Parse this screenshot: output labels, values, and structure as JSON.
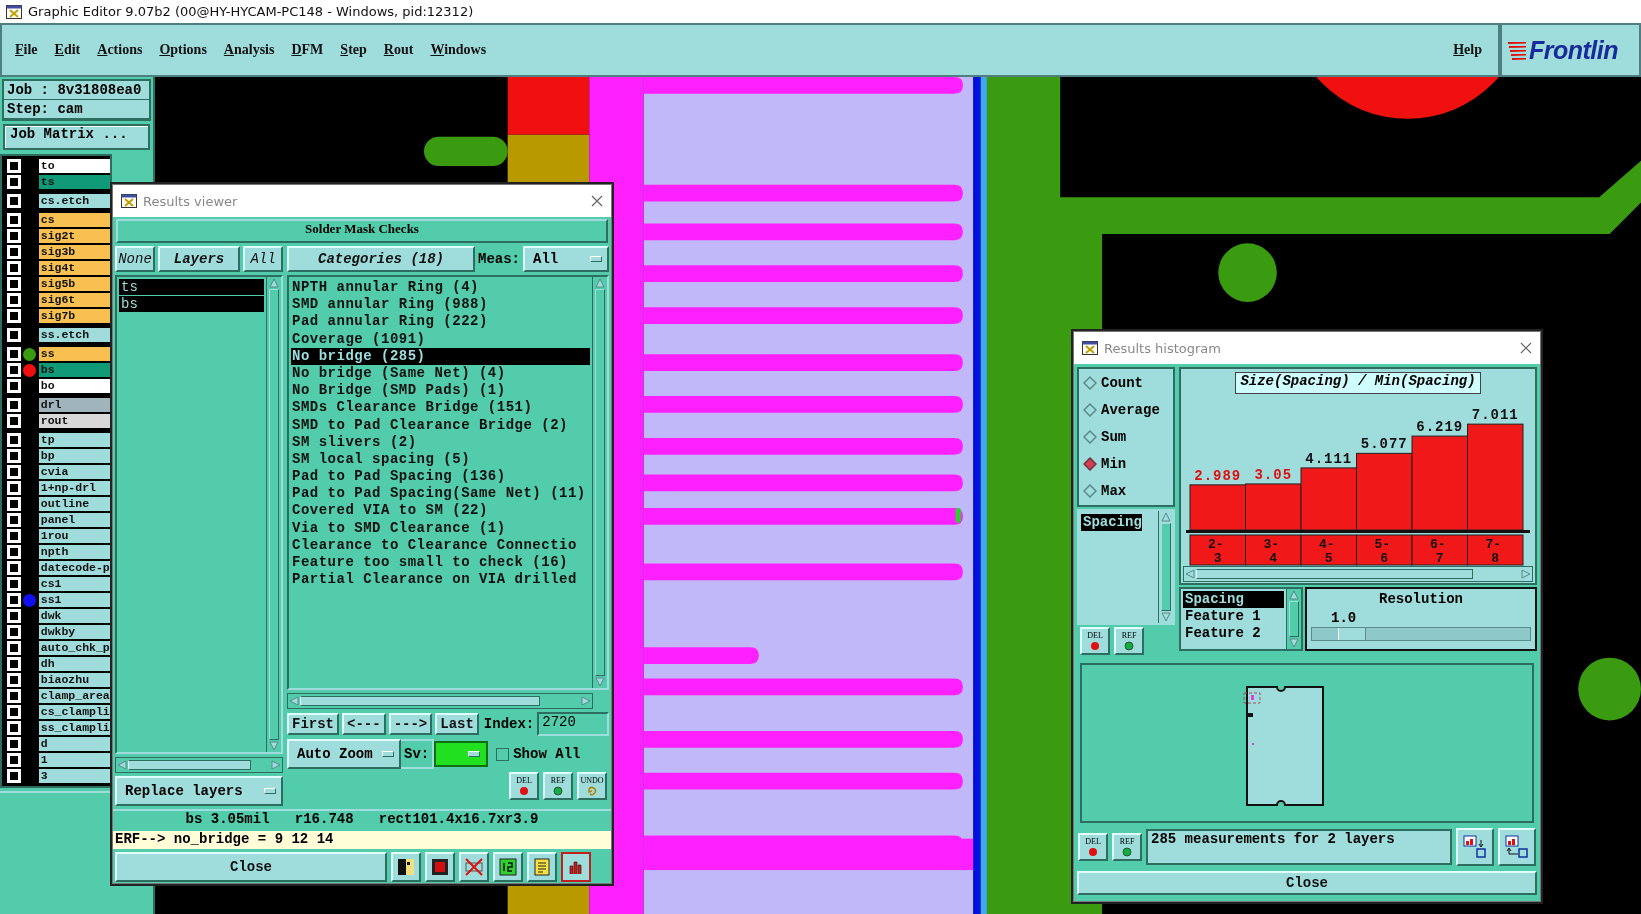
{
  "window": {
    "title": "Graphic Editor 9.07b2 (00@HY-HYCAM-PC148 - Windows, pid:12312)"
  },
  "menu": [
    {
      "label": "File"
    },
    {
      "label": "Edit"
    },
    {
      "label": "Actions"
    },
    {
      "label": "Options"
    },
    {
      "label": "Analysis"
    },
    {
      "label": "DFM"
    },
    {
      "label": "Step"
    },
    {
      "label": "Rout"
    },
    {
      "label": "Windows"
    }
  ],
  "help": "Help",
  "logo": "Frontlin",
  "job_panel": {
    "job": "Job : 8v31808ea0",
    "step": "Step: cam",
    "matrix_button": "Job Matrix ..."
  },
  "layer_groups": [
    {
      "layers": [
        {
          "name": "to",
          "color": "#ffffff",
          "checked": false
        },
        {
          "name": "ts",
          "color": "#109a78",
          "checked": false
        }
      ]
    },
    {
      "layers": [
        {
          "name": "cs.etch",
          "color": "#a0dcdc",
          "checked": false
        }
      ]
    },
    {
      "layers": [
        {
          "name": "cs",
          "color": "#f8c050",
          "checked": false
        },
        {
          "name": "sig2t",
          "color": "#f8c050",
          "checked": false
        },
        {
          "name": "sig3b",
          "color": "#f8c050",
          "checked": false
        },
        {
          "name": "sig4t",
          "color": "#f8c050",
          "checked": false
        },
        {
          "name": "sig5b",
          "color": "#f8c050",
          "checked": false
        },
        {
          "name": "sig6t",
          "color": "#f8c050",
          "checked": false
        },
        {
          "name": "sig7b",
          "color": "#f8c050",
          "checked": false
        }
      ]
    },
    {
      "layers": [
        {
          "name": "ss.etch",
          "color": "#a0dcdc",
          "checked": false
        }
      ]
    },
    {
      "layers": [
        {
          "name": "ss",
          "color": "#f8c050",
          "checked": false,
          "marker": {
            "color": "#3a9a10"
          }
        },
        {
          "name": "bs",
          "color": "#109a78",
          "checked": false,
          "marker": {
            "color": "#f01010"
          }
        },
        {
          "name": "bo",
          "color": "#ffffff",
          "checked": false
        }
      ]
    },
    {
      "layers": [
        {
          "name": "drl",
          "color": "#a0b4bc",
          "checked": false
        },
        {
          "name": "rout",
          "color": "#d8d8d8",
          "checked": false
        }
      ]
    },
    {
      "layers": [
        {
          "name": "tp",
          "color": "#a0dcdc",
          "checked": false
        },
        {
          "name": "bp",
          "color": "#a0dcdc",
          "checked": false
        },
        {
          "name": "cvia",
          "color": "#a0dcdc",
          "checked": false
        },
        {
          "name": "1+np-drl",
          "color": "#a0dcdc",
          "checked": false
        },
        {
          "name": "outline",
          "color": "#a0dcdc",
          "checked": false
        },
        {
          "name": "panel",
          "color": "#a0dcdc",
          "checked": false
        },
        {
          "name": "1rou",
          "color": "#a0dcdc",
          "checked": false
        },
        {
          "name": "npth",
          "color": "#a0dcdc",
          "checked": false
        },
        {
          "name": "datecode-p",
          "color": "#a0dcdc",
          "checked": false
        },
        {
          "name": "cs1",
          "color": "#a0dcdc",
          "checked": false
        },
        {
          "name": "ss1",
          "color": "#a0dcdc",
          "checked": false,
          "marker": {
            "color": "#1010f0"
          }
        },
        {
          "name": "dwk",
          "color": "#a0dcdc",
          "checked": false
        },
        {
          "name": "dwkby",
          "color": "#a0dcdc",
          "checked": false
        },
        {
          "name": "auto_chk_p",
          "color": "#a0dcdc",
          "checked": false
        },
        {
          "name": "dh",
          "color": "#a0dcdc",
          "checked": false
        },
        {
          "name": "biaozhu",
          "color": "#a0dcdc",
          "checked": false
        },
        {
          "name": "clamp_area",
          "color": "#a0dcdc",
          "checked": false
        },
        {
          "name": "cs_clampli",
          "color": "#a0dcdc",
          "checked": false
        },
        {
          "name": "ss_clampli",
          "color": "#a0dcdc",
          "checked": false
        },
        {
          "name": "d",
          "color": "#a0dcdc",
          "checked": false
        },
        {
          "name": "1",
          "color": "#a0dcdc",
          "checked": false
        },
        {
          "name": "3",
          "color": "#a0dcdc",
          "checked": false
        }
      ]
    }
  ],
  "results_viewer": {
    "title": "Results viewer",
    "header": "Solder Mask Checks",
    "layer_buttons": [
      "None",
      "Layers",
      "All"
    ],
    "layers": [
      {
        "name": "ts",
        "selected": true
      },
      {
        "name": "bs",
        "selected": true
      }
    ],
    "replace_button": "Replace layers",
    "categories_button": "Categories (18)",
    "meas_label": "Meas:",
    "meas_value": "All",
    "categories": [
      {
        "label": "NPTH annular Ring (4)",
        "selected": false
      },
      {
        "label": "SMD annular Ring (988)",
        "selected": false
      },
      {
        "label": "Pad annular Ring (222)",
        "selected": false
      },
      {
        "label": "Coverage (1091)",
        "selected": false
      },
      {
        "label": "No bridge (285)",
        "selected": true
      },
      {
        "label": "No bridge (Same Net) (4)",
        "selected": false
      },
      {
        "label": "No Bridge (SMD Pads) (1)",
        "selected": false
      },
      {
        "label": "SMDs Clearance Bridge (151)",
        "selected": false
      },
      {
        "label": "SMD to Pad Clearance Bridge (2)",
        "selected": false
      },
      {
        "label": "SM slivers (2)",
        "selected": false
      },
      {
        "label": "SM local spacing (5)",
        "selected": false
      },
      {
        "label": "Pad to Pad Spacing (136)",
        "selected": false
      },
      {
        "label": "Pad to Pad Spacing(Same Net) (11)",
        "selected": false
      },
      {
        "label": "Covered VIA to SM (22)",
        "selected": false
      },
      {
        "label": "Via to SMD Clearance (1)",
        "selected": false
      },
      {
        "label": "Clearance to Clearance Connectio",
        "selected": false
      },
      {
        "label": "Feature too small to check (16)",
        "selected": false
      },
      {
        "label": "Partial Clearance on VIA drilled",
        "selected": false
      }
    ],
    "nav_buttons": [
      "First",
      "<---",
      "--->",
      "Last"
    ],
    "index_label": "Index:",
    "index_value": "2720",
    "zoom_mode": "Auto Zoom",
    "sv_label": "Sv:",
    "show_all": {
      "label": "Show All",
      "checked": false
    },
    "tool_buttons": [
      "DEL",
      "REF",
      "UNDO"
    ],
    "status": "bs 3.05mil   r16.748   rect101.4x16.7xr3.9",
    "erf": "ERF--> no_bridge = 9 12 14",
    "close": "Close",
    "bottom_tools": [
      {
        "kind": "figure",
        "selected": false
      },
      {
        "kind": "stop",
        "selected": false
      },
      {
        "kind": "ref-off",
        "selected": false
      },
      {
        "kind": "numbers",
        "selected": false
      },
      {
        "kind": "report",
        "selected": false
      },
      {
        "kind": "chart",
        "selected": true
      }
    ]
  },
  "results_histogram": {
    "title": "Results histogram",
    "functions": [
      {
        "label": "Count",
        "selected": false
      },
      {
        "label": "Average",
        "selected": false
      },
      {
        "label": "Sum",
        "selected": false
      },
      {
        "label": "Min",
        "selected": true
      },
      {
        "label": "Max",
        "selected": false
      }
    ],
    "attributes": [
      {
        "label": "Spacing",
        "selected": true
      }
    ],
    "tool_buttons": [
      "DEL",
      "REF"
    ],
    "flagged_labels": [
      true,
      true,
      false,
      false,
      false,
      false
    ],
    "chart_data": {
      "type": "bar",
      "title": "Size(Spacing) / Min(Spacing)",
      "categories": [
        "2-3",
        "3-4",
        "4-5",
        "5-6",
        "6-7",
        "7-8"
      ],
      "values": [
        2.989,
        3.05,
        4.111,
        5.077,
        6.219,
        7.011
      ],
      "value_labels": [
        "2.989",
        "3.05",
        "4.111",
        "5.077",
        "6.219",
        "7.011"
      ]
    },
    "fields": [
      {
        "label": "Spacing",
        "selected": true
      },
      {
        "label": "Feature 1",
        "selected": false
      },
      {
        "label": "Feature 2",
        "selected": false
      }
    ],
    "resolution": {
      "label": "Resolution",
      "value": "1.0",
      "level": 0.12
    },
    "bottom_tools": [
      "DEL",
      "REF"
    ],
    "summary": "285 measurements for 2 layers",
    "close": "Close"
  }
}
